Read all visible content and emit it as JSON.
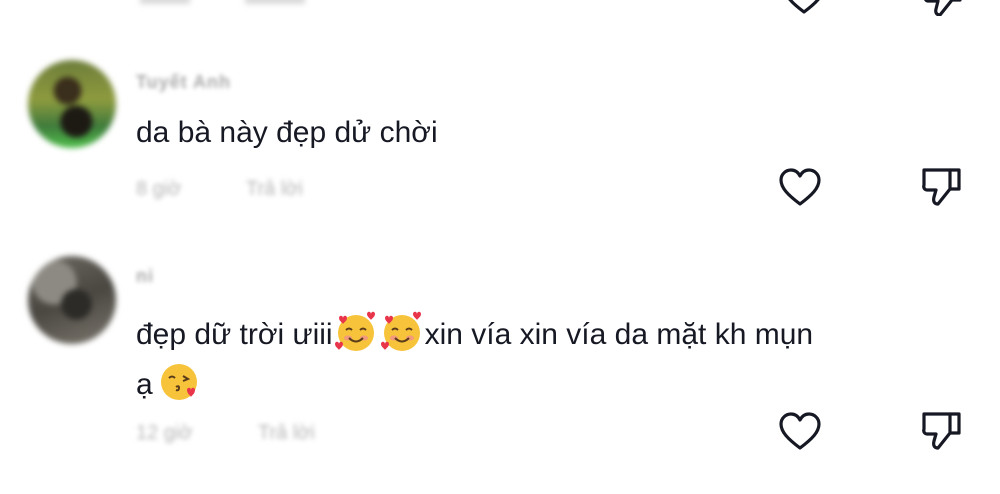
{
  "comments": [
    {
      "username": "Tuyết Anh",
      "text": "da bà này đẹp dử chời",
      "time": "8 giờ",
      "reply_label": "Trả lời"
    },
    {
      "username": "ni",
      "text_line1_part1": "đẹp dữ trời ưiii",
      "text_line1_part2": "xin vía xin vía da mặt kh mụn",
      "text_line2": "ạ",
      "time": "12 giờ",
      "reply_label": "Trả lời"
    }
  ],
  "icons": {
    "like": "heart-outline-icon",
    "dislike": "thumbs-down-outline-icon",
    "emoji_hearts": "smiling-face-with-hearts-emoji",
    "emoji_kiss": "face-blowing-kiss-emoji"
  },
  "colors": {
    "text": "#161823",
    "muted": "#b5b5b5",
    "icon": "#161823"
  }
}
